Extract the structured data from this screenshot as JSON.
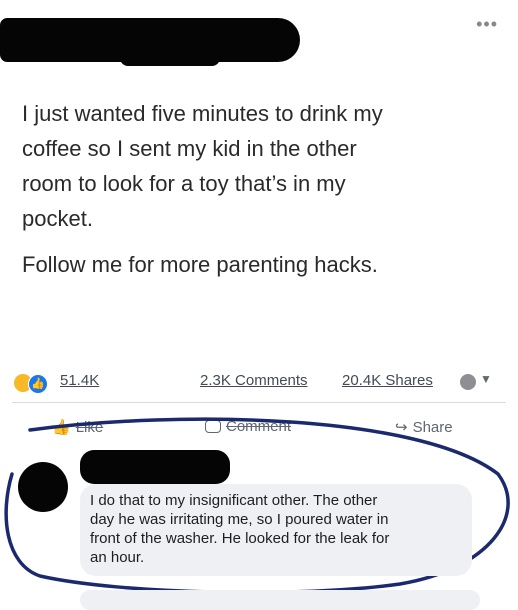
{
  "header": {
    "menu_icon": "more-dots-icon",
    "menu_label": "•••"
  },
  "post": {
    "lines": [
      "I just wanted five minutes to drink my",
      "coffee so I sent my kid in the other",
      "room to look for a toy that’s in my",
      "pocket."
    ],
    "line2": "Follow me for more parenting hacks."
  },
  "stats": {
    "reactions": "51.4K",
    "comments": "2.3K Comments",
    "shares": "20.4K Shares"
  },
  "actions": {
    "like": "Like",
    "comment": "Comment",
    "share": "Share"
  },
  "comment": {
    "lines": [
      "I do that to my insignificant other.  The other",
      "day he was irritating me, so I poured water in",
      "front of the washer.  He looked for the leak for",
      "an hour."
    ]
  },
  "colors": {
    "annotation_ink": "#1b2a6e",
    "reaction_like": "#1877f2",
    "reaction_haha": "#f7b928"
  }
}
